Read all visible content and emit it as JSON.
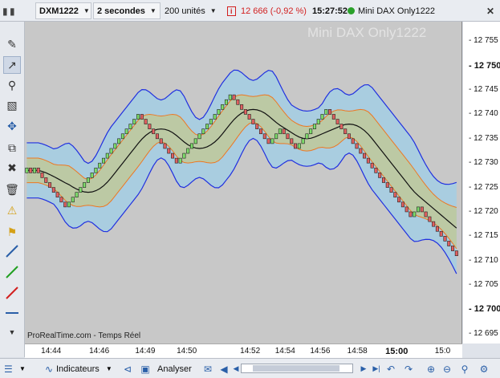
{
  "toolbar": {
    "symbol": "DXM1222",
    "timeframe": "2 secondes",
    "units": "200 unités",
    "price": "12 666",
    "change": "(-0,92 %)",
    "time": "15:27:52",
    "instrument": "Mini DAX Only1222",
    "info_icon": "info-icon",
    "close_icon": "close-icon"
  },
  "left_tools": [
    "pencil-icon",
    "cursor-icon",
    "zoom-icon",
    "ruler-icon",
    "crosshair-icon",
    "copy-icon",
    "tools-icon",
    "trash-icon",
    "alert-remove-icon",
    "alert-icon",
    "line-tool-icon",
    "green-line-icon",
    "red-line-icon",
    "horizontal-line-icon",
    "collapse-icon"
  ],
  "chart": {
    "watermark": "Mini DAX Only1222",
    "source": "ProRealTime.com - Temps Réel",
    "colors": {
      "up": "#7ddc6a",
      "down": "#e06060",
      "outer_band": "#2030e0",
      "inner_band": "#ee7722",
      "ma": "#111111",
      "outer_fill": "#a9cde0",
      "inner_fill": "#bcc9a4"
    }
  },
  "chart_data": {
    "type": "renko",
    "y_ticks": [
      "12 755",
      "12 750",
      "12 745",
      "12 740",
      "12 735",
      "12 730",
      "12 725",
      "12 720",
      "12 715",
      "12 710",
      "12 705",
      "12 700",
      "12 695"
    ],
    "y_major": [
      "12 750",
      "12 700"
    ],
    "x_ticks": [
      "14:44",
      "14:46",
      "14:49",
      "14:50",
      "14:52",
      "14:54",
      "14:56",
      "14:58",
      "15:00",
      "15:0"
    ],
    "x_major": [
      "15:00"
    ],
    "ylim": [
      12693,
      12759
    ],
    "brick_size": 1,
    "brick_tops": [
      12729,
      12728,
      12729,
      12728,
      12727,
      12726,
      12725,
      12724,
      12723,
      12722,
      12721,
      12722,
      12723,
      12724,
      12725,
      12726,
      12727,
      12728,
      12729,
      12730,
      12731,
      12732,
      12733,
      12734,
      12735,
      12736,
      12737,
      12738,
      12739,
      12740,
      12739,
      12738,
      12737,
      12736,
      12735,
      12734,
      12733,
      12732,
      12731,
      12730,
      12731,
      12732,
      12733,
      12734,
      12735,
      12736,
      12737,
      12738,
      12739,
      12740,
      12741,
      12742,
      12743,
      12744,
      12743,
      12742,
      12741,
      12740,
      12739,
      12738,
      12737,
      12736,
      12735,
      12734,
      12735,
      12736,
      12737,
      12736,
      12735,
      12734,
      12733,
      12734,
      12735,
      12736,
      12737,
      12738,
      12739,
      12740,
      12741,
      12740,
      12739,
      12738,
      12737,
      12736,
      12735,
      12734,
      12733,
      12732,
      12731,
      12730,
      12729,
      12728,
      12727,
      12726,
      12725,
      12724,
      12723,
      12722,
      12721,
      12720,
      12719,
      12720,
      12721,
      12720,
      12719,
      12718,
      12717,
      12716,
      12715,
      12714,
      12713,
      12712,
      12711
    ]
  },
  "bottom": {
    "indicators_label": "Indicateurs",
    "analyzer_label": "Analyser"
  }
}
